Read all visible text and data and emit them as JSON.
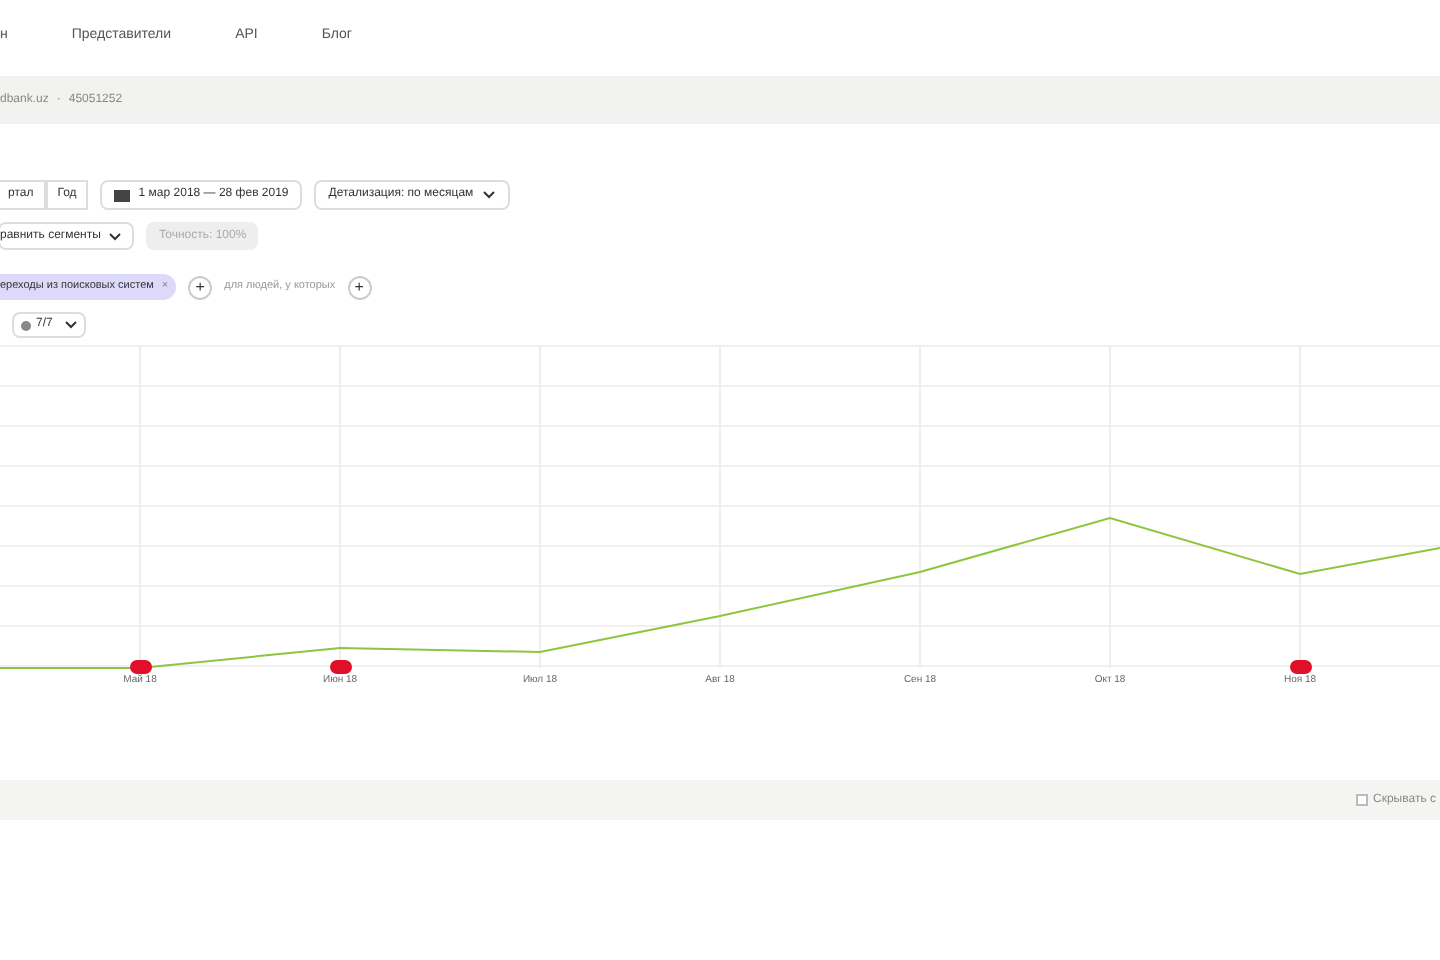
{
  "nav": {
    "items": [
      "н",
      "Представители",
      "API",
      "Блог"
    ]
  },
  "breadcrumb": {
    "site": "dbank.uz",
    "separator": "·",
    "counter": "45051252"
  },
  "period_buttons": [
    {
      "label": "ртал",
      "selected": false
    },
    {
      "label": "Год",
      "selected": false
    }
  ],
  "date_range": "1 мар 2018 — 28 фев 2019",
  "detail_dropdown": "Детализация: по месяцам",
  "segments_button": "равнить сегменты",
  "accuracy_dropdown": {
    "label": "Точность: 100%",
    "disabled": true
  },
  "filter": {
    "chip": "ереходы из поисковых систем",
    "remove": "×",
    "add": "+",
    "condition": "для людей, у которых",
    "add2": "+"
  },
  "goals_dropdown": "7/7",
  "chart": {
    "months": [
      {
        "label": "Май 18",
        "annotated": true
      },
      {
        "label": "Июн 18",
        "annotated": true
      },
      {
        "label": "Июл 18",
        "annotated": false
      },
      {
        "label": "Авг 18",
        "annotated": false
      },
      {
        "label": "Сен 18",
        "annotated": false
      },
      {
        "label": "Окт 18",
        "annotated": false
      },
      {
        "label": "Ноя 18",
        "annotated": true
      }
    ]
  },
  "bottom_bar": {
    "hide_checkbox": {
      "label": "Скрывать с",
      "checked": false
    }
  }
}
